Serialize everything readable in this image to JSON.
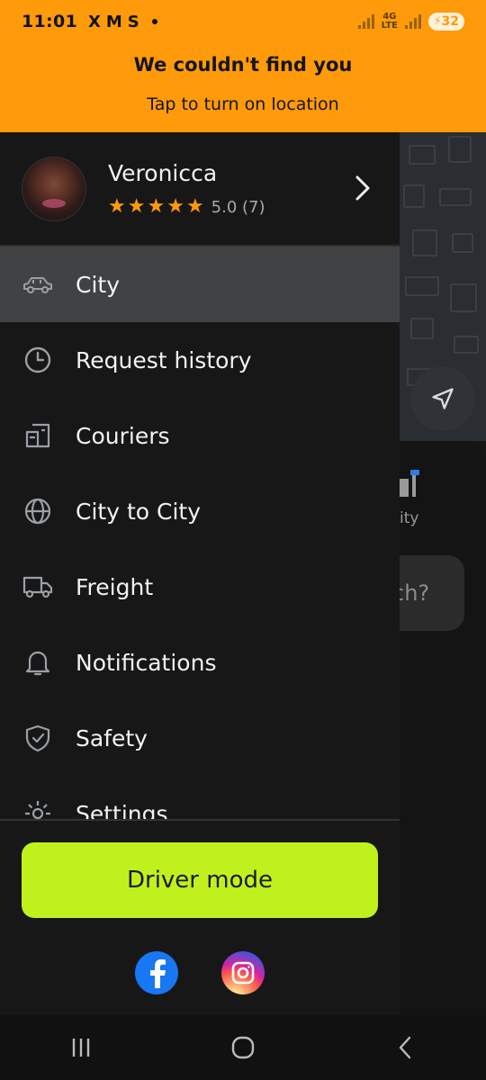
{
  "status_bar": {
    "time": "11:01",
    "app_icons": [
      "X",
      "M",
      "S"
    ],
    "battery": "32"
  },
  "location_notice": {
    "title": "We couldn't find you",
    "subtitle": "Tap to turn on location"
  },
  "profile": {
    "name": "Veronicca",
    "rating": "5.0 (7)",
    "stars": 5
  },
  "menu": {
    "items": [
      {
        "label": "City",
        "icon": "car-icon",
        "active": true
      },
      {
        "label": "Request history",
        "icon": "clock-icon",
        "active": false
      },
      {
        "label": "Couriers",
        "icon": "box-icon",
        "active": false
      },
      {
        "label": "City to City",
        "icon": "globe-icon",
        "active": false
      },
      {
        "label": "Freight",
        "icon": "truck-icon",
        "active": false
      },
      {
        "label": "Notifications",
        "icon": "bell-icon",
        "active": false
      },
      {
        "label": "Safety",
        "icon": "shield-icon",
        "active": false
      },
      {
        "label": "Settings",
        "icon": "gear-icon",
        "active": false
      }
    ]
  },
  "driver_mode": {
    "label": "Driver mode"
  },
  "background_sheet": {
    "city_label": "ity",
    "search_partial": "ch?"
  },
  "colors": {
    "accent_orange": "#FF9A0A",
    "driver_green": "#C1F11D",
    "drawer_bg": "#171717",
    "active_item_bg": "#404244"
  }
}
